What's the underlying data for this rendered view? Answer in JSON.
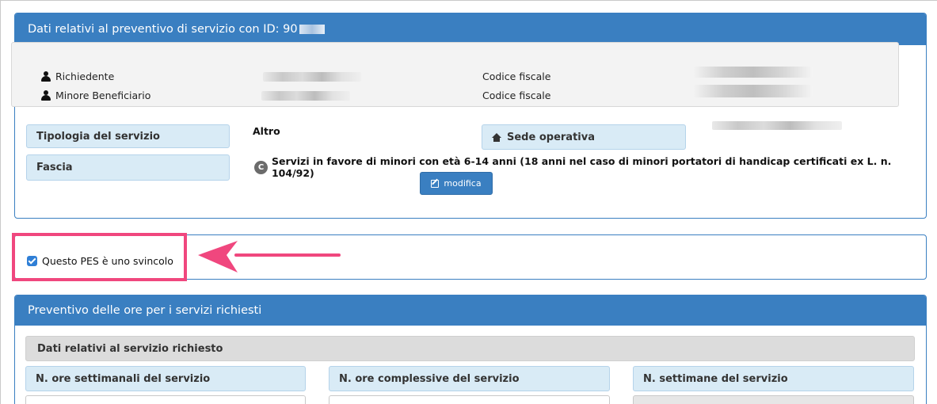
{
  "panel_service": {
    "title": "Dati relativi al preventivo di servizio con ID: 90",
    "requester_label": "Richiedente",
    "beneficiary_label": "Minore Beneficiario",
    "tax_code_label_1": "Codice fiscale",
    "tax_code_label_2": "Codice fiscale",
    "service_type_label": "Tipologia del servizio",
    "service_type_value": "Altro",
    "band_label": "Fascia",
    "band_badge": "C",
    "band_value": "Servizi in favore di minori con età 6-14 anni (18 anni nel caso di minori portatori di handicap certificati ex L. n. 104/92)",
    "office_label": "Sede operativa",
    "edit_button": "modifica"
  },
  "release_panel": {
    "checkbox_label": "Questo PES è uno svincolo",
    "checked": true
  },
  "hours_panel": {
    "title": "Preventivo delle ore per i servizi richiesti",
    "section_label": "Dati relativi al servizio richiesto",
    "weekly_hours_label": "N. ore settimanali del servizio",
    "total_hours_label": "N. ore complessive del servizio",
    "weeks_label": "N. settimane del servizio"
  },
  "colors": {
    "primary": "#3a7fc1",
    "field_box": "#d9ebf6",
    "annotation": "#f0477e"
  }
}
